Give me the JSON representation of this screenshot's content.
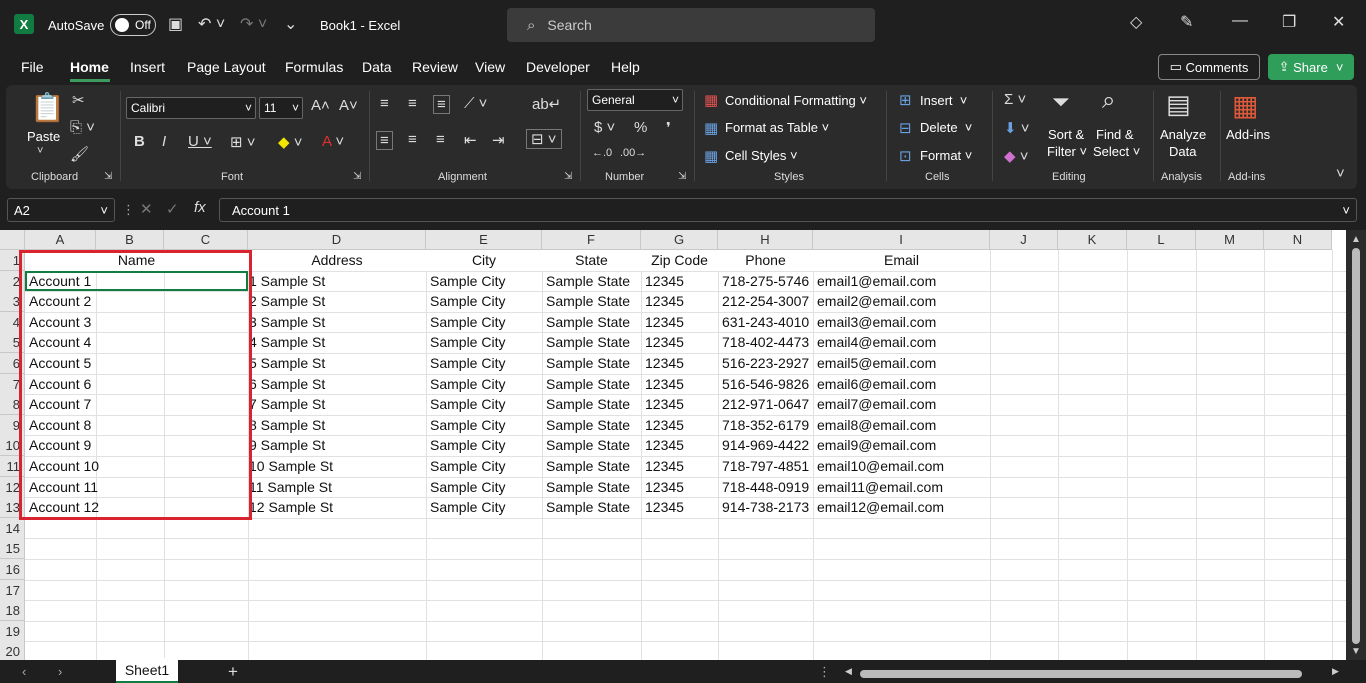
{
  "titlebar": {
    "autosave_label": "AutoSave",
    "autosave_state": "Off",
    "doc_title": "Book1  -  Excel",
    "search_placeholder": "Search"
  },
  "menu": [
    "File",
    "Home",
    "Insert",
    "Page Layout",
    "Formulas",
    "Data",
    "Review",
    "View",
    "Developer",
    "Help"
  ],
  "actions": {
    "comments": "Comments",
    "share": "Share"
  },
  "ribbon": {
    "paste": "Paste",
    "font_name": "Calibri",
    "font_size": "11",
    "number_format": "General",
    "conditional_formatting": "Conditional Formatting",
    "format_as_table": "Format as Table",
    "cell_styles": "Cell Styles",
    "insert": "Insert",
    "delete": "Delete",
    "format": "Format",
    "sort_filter_1": "Sort &",
    "sort_filter_2": "Filter",
    "find_select_1": "Find &",
    "find_select_2": "Select",
    "analyze_1": "Analyze",
    "analyze_2": "Data",
    "addins": "Add-ins",
    "groups": {
      "clipboard": "Clipboard",
      "font": "Font",
      "alignment": "Alignment",
      "number": "Number",
      "styles": "Styles",
      "cells": "Cells",
      "editing": "Editing",
      "analysis": "Analysis",
      "addins": "Add-ins"
    }
  },
  "formula_bar": {
    "name_box": "A2",
    "formula": "Account 1"
  },
  "columns": [
    "A",
    "B",
    "C",
    "D",
    "E",
    "F",
    "G",
    "H",
    "I",
    "J",
    "K",
    "L",
    "M",
    "N"
  ],
  "rows": [
    "1",
    "2",
    "3",
    "4",
    "5",
    "6",
    "7",
    "8",
    "9",
    "10",
    "11",
    "12",
    "13",
    "14",
    "15",
    "16",
    "17",
    "18",
    "19",
    "20"
  ],
  "headers": [
    "Name",
    "Address",
    "City",
    "State",
    "Zip Code",
    "Phone",
    "Email"
  ],
  "records": [
    [
      "Account 1",
      "1 Sample St",
      "Sample City",
      "Sample State",
      "12345",
      "718-275-5746",
      "email1@email.com"
    ],
    [
      "Account 2",
      "2 Sample St",
      "Sample City",
      "Sample State",
      "12345",
      "212-254-3007",
      "email2@email.com"
    ],
    [
      "Account 3",
      "3 Sample St",
      "Sample City",
      "Sample State",
      "12345",
      "631-243-4010",
      "email3@email.com"
    ],
    [
      "Account 4",
      "4 Sample St",
      "Sample City",
      "Sample State",
      "12345",
      "718-402-4473",
      "email4@email.com"
    ],
    [
      "Account 5",
      "5 Sample St",
      "Sample City",
      "Sample State",
      "12345",
      "516-223-2927",
      "email5@email.com"
    ],
    [
      "Account 6",
      "6 Sample St",
      "Sample City",
      "Sample State",
      "12345",
      "516-546-9826",
      "email6@email.com"
    ],
    [
      "Account 7",
      "7 Sample St",
      "Sample City",
      "Sample State",
      "12345",
      "212-971-0647",
      "email7@email.com"
    ],
    [
      "Account 8",
      "8 Sample St",
      "Sample City",
      "Sample State",
      "12345",
      "718-352-6179",
      "email8@email.com"
    ],
    [
      "Account 9",
      "9 Sample St",
      "Sample City",
      "Sample State",
      "12345",
      "914-969-4422",
      "email9@email.com"
    ],
    [
      "Account 10",
      "10 Sample St",
      "Sample City",
      "Sample State",
      "12345",
      "718-797-4851",
      "email10@email.com"
    ],
    [
      "Account 11",
      "11 Sample St",
      "Sample City",
      "Sample State",
      "12345",
      "718-448-0919",
      "email11@email.com"
    ],
    [
      "Account 12",
      "12 Sample St",
      "Sample City",
      "Sample State",
      "12345",
      "914-738-2173",
      "email12@email.com"
    ]
  ],
  "sheet_tab": "Sheet1",
  "colors": {
    "accent": "#107c41",
    "highlight": "#d9232e",
    "share": "#2f9e5a"
  }
}
